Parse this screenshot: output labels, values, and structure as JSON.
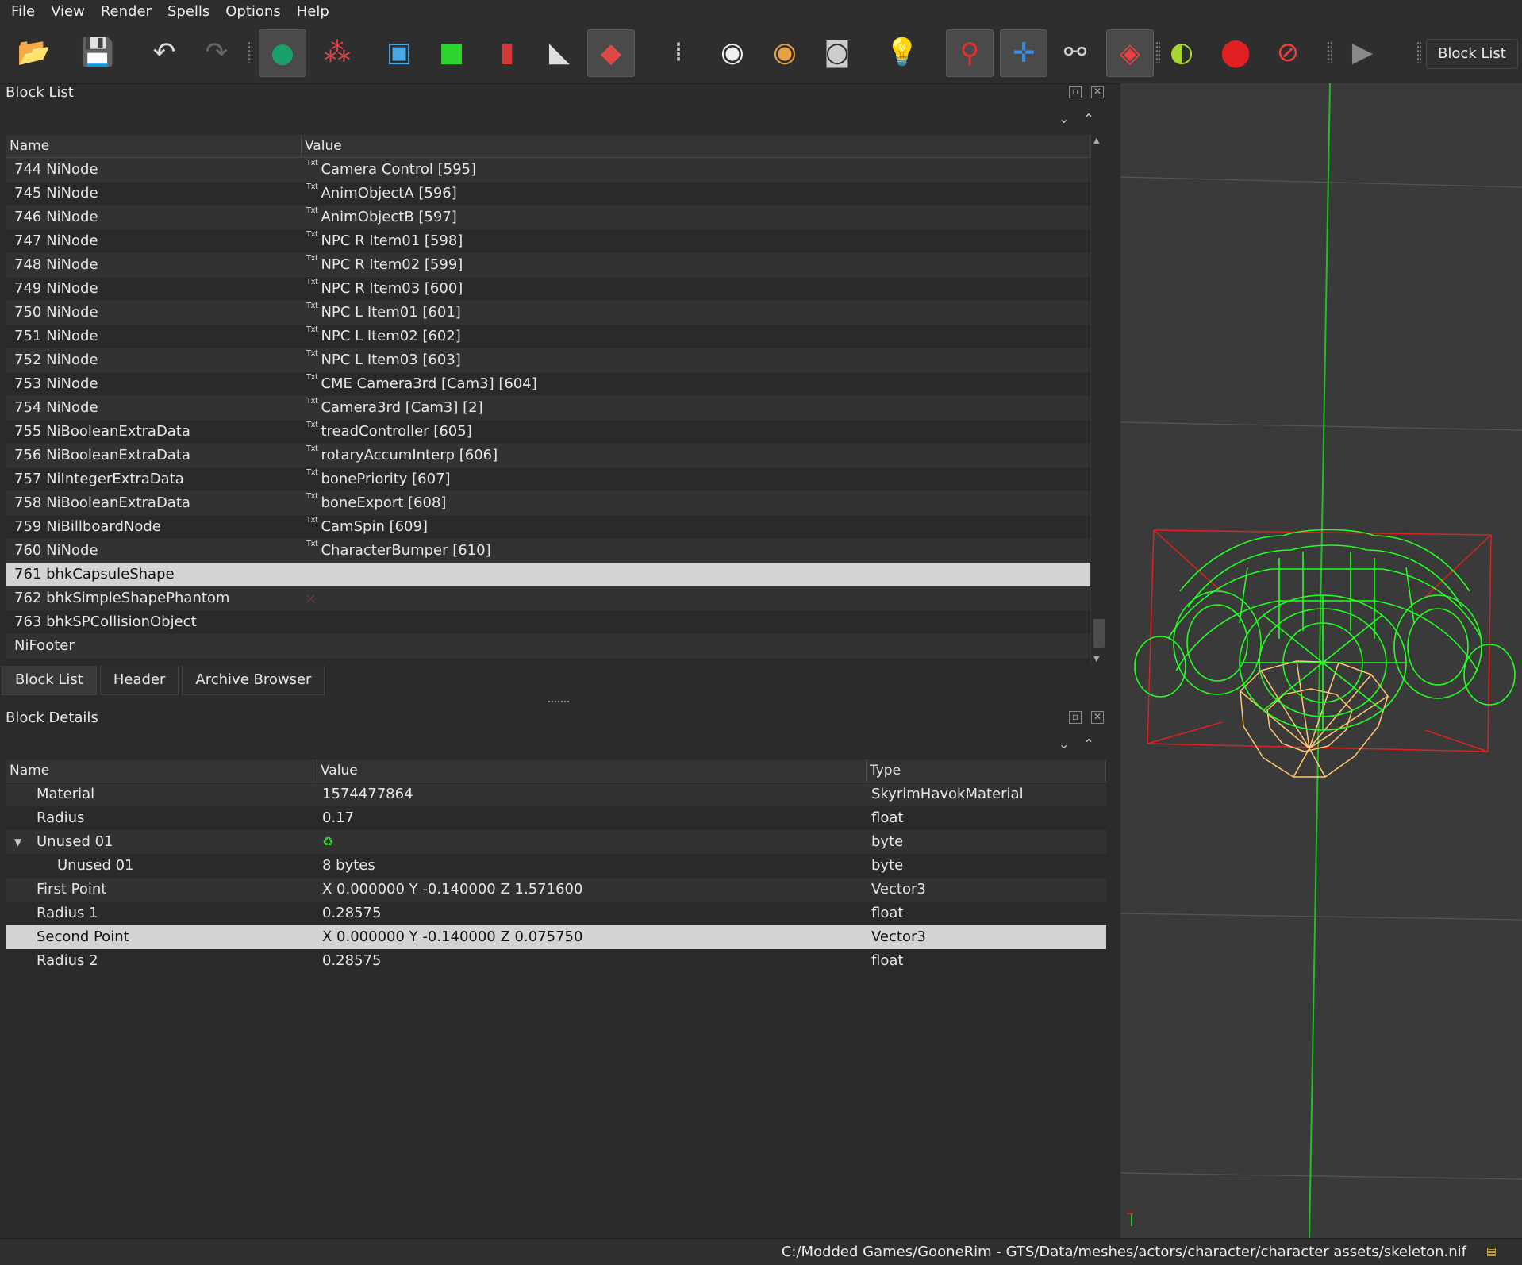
{
  "menu": [
    "File",
    "View",
    "Render",
    "Spells",
    "Options",
    "Help"
  ],
  "toolbar": {
    "icons": [
      "load-icon",
      "save-icon",
      "undo-icon",
      "redo-icon",
      "select-object-icon",
      "select-vertex-icon",
      "view-top-icon",
      "view-front-icon",
      "view-side-icon",
      "view-walk-icon",
      "view-user-icon",
      "footprints-icon",
      "eye-icon",
      "eye-edit-icon",
      "screenshot-icon",
      "lightbulb-icon",
      "marker-icon",
      "axes-icon",
      "nodes-icon",
      "havok-icon",
      "constraints-icon",
      "pin-icon",
      "hidden-icon",
      "play-icon"
    ],
    "block_list_button": "Block List"
  },
  "block_list": {
    "title": "Block List",
    "columns": [
      "Name",
      "Value"
    ],
    "rows": [
      {
        "name": "744 NiNode",
        "value": "Camera Control [595]",
        "txt": true
      },
      {
        "name": "745 NiNode",
        "value": "AnimObjectA [596]",
        "txt": true
      },
      {
        "name": "746 NiNode",
        "value": "AnimObjectB [597]",
        "txt": true
      },
      {
        "name": "747 NiNode",
        "value": "NPC R Item01 [598]",
        "txt": true
      },
      {
        "name": "748 NiNode",
        "value": "NPC R Item02 [599]",
        "txt": true
      },
      {
        "name": "749 NiNode",
        "value": "NPC R Item03 [600]",
        "txt": true
      },
      {
        "name": "750 NiNode",
        "value": "NPC L Item01 [601]",
        "txt": true
      },
      {
        "name": "751 NiNode",
        "value": "NPC L Item02 [602]",
        "txt": true
      },
      {
        "name": "752 NiNode",
        "value": "NPC L Item03 [603]",
        "txt": true
      },
      {
        "name": "753 NiNode",
        "value": "CME Camera3rd [Cam3] [604]",
        "txt": true
      },
      {
        "name": "754 NiNode",
        "value": "Camera3rd [Cam3] [2]",
        "txt": true
      },
      {
        "name": "755 NiBooleanExtraData",
        "value": "treadController [605]",
        "txt": true
      },
      {
        "name": "756 NiBooleanExtraData",
        "value": "rotaryAccumInterp [606]",
        "txt": true
      },
      {
        "name": "757 NiIntegerExtraData",
        "value": "bonePriority [607]",
        "txt": true
      },
      {
        "name": "758 NiBooleanExtraData",
        "value": "boneExport [608]",
        "txt": true
      },
      {
        "name": "759 NiBillboardNode",
        "value": "CamSpin [609]",
        "txt": true
      },
      {
        "name": "760 NiNode",
        "value": "CharacterBumper [610]",
        "txt": true
      },
      {
        "name": "761 bhkCapsuleShape",
        "value": "",
        "txt": false,
        "selected": true
      },
      {
        "name": "762 bhkSimpleShapePhantom",
        "value": "",
        "txt": false,
        "axes": true
      },
      {
        "name": "763 bhkSPCollisionObject",
        "value": "",
        "txt": false
      },
      {
        "name": "NiFooter",
        "value": "",
        "txt": false
      }
    ]
  },
  "tabs": [
    "Block List",
    "Header",
    "Archive Browser"
  ],
  "block_details": {
    "title": "Block Details",
    "columns": [
      "Name",
      "Value",
      "Type"
    ],
    "rows": [
      {
        "name": "Material",
        "value": "1574477864",
        "type": "SkyrimHavokMaterial",
        "indent": 1
      },
      {
        "name": "Radius",
        "value": "0.17",
        "type": "float",
        "indent": 1
      },
      {
        "name": "Unused 01",
        "value": "",
        "type": "byte",
        "indent": 1,
        "expanded": true,
        "refresh": true
      },
      {
        "name": "Unused 01",
        "value": "8 bytes",
        "type": "byte",
        "indent": 2
      },
      {
        "name": "First Point",
        "value": "X 0.000000 Y -0.140000 Z 1.571600",
        "type": "Vector3",
        "indent": 1
      },
      {
        "name": "Radius 1",
        "value": "0.28575",
        "type": "float",
        "indent": 1
      },
      {
        "name": "Second Point",
        "value": "X 0.000000 Y -0.140000 Z 0.075750",
        "type": "Vector3",
        "indent": 1,
        "selected": true
      },
      {
        "name": "Radius 2",
        "value": "0.28575",
        "type": "float",
        "indent": 1
      }
    ]
  },
  "status": {
    "path": "C:/Modded Games/GooneRim - GTS/Data/meshes/actors/character/character assets/skeleton.nif"
  },
  "colors": {
    "wire_green": "#22ff22",
    "wire_orange": "#ffc870",
    "bbox_red": "#dd2222",
    "axis_green": "#20c020"
  }
}
